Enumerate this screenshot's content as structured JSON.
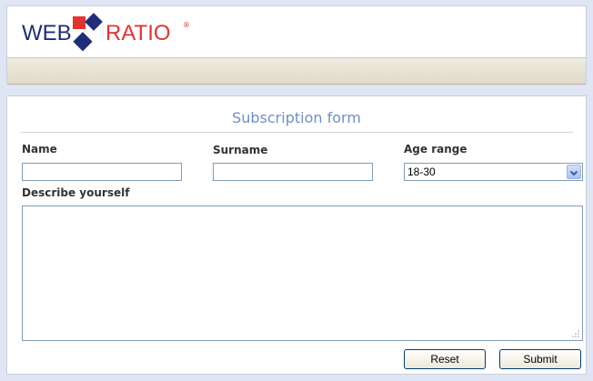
{
  "brand": {
    "logo_left": "WEB",
    "logo_right": "RATIO",
    "logo_mark": "®"
  },
  "form": {
    "title": "Subscription form",
    "name_label": "Name",
    "surname_label": "Surname",
    "age_label": "Age range",
    "age_selected": "18-30",
    "describe_label": "Describe yourself",
    "name_value": "",
    "surname_value": "",
    "describe_value": ""
  },
  "buttons": {
    "reset": "Reset",
    "submit": "Submit"
  },
  "colors": {
    "title": "#6e8fcb",
    "logo_blue": "#1f2e78",
    "logo_red": "#e3342f"
  },
  "icons": {
    "select_arrow": "chevron-down-icon",
    "resize_grip": "resize-grip-icon"
  }
}
